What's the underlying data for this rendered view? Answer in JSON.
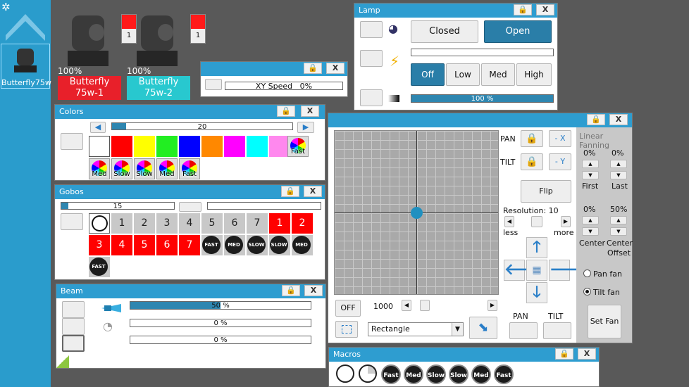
{
  "sidebar": {
    "fixture_label": "Butterfly75w",
    "up_icon": "chevron-up-icon",
    "settings_icon": "gear-icon"
  },
  "fixtures": [
    {
      "intensity": "100%",
      "name_line1": "Butterfly",
      "name_line2": "75w-1",
      "badge": "1",
      "color": "#e8202a"
    },
    {
      "intensity": "100%",
      "name_line1": "Butterfly",
      "name_line2": "75w-2",
      "badge": "1",
      "color": "#28c8cf"
    }
  ],
  "xy_speed": {
    "label": "XY Speed",
    "value": "0%",
    "close": "X"
  },
  "lamp": {
    "title": "Lamp",
    "close": "X",
    "closed": "Closed",
    "open": "Open",
    "off": "Off",
    "low": "Low",
    "med": "Med",
    "high": "High",
    "dimmer": "100 %",
    "dimmer_fraction": 1.0
  },
  "colors": {
    "title": "Colors",
    "close": "X",
    "value": "20",
    "value_fraction": 0.08,
    "swatches": [
      "#ffffff",
      "#ff0000",
      "#ffff00",
      "#22ee22",
      "#0000ff",
      "#ff8800",
      "#ff00ff",
      "#00ffff",
      "#ff88ee"
    ],
    "wheel_labels": [
      "Fast",
      "Med",
      "Slow",
      "Slow",
      "Med",
      "Fast"
    ]
  },
  "gobos": {
    "title": "Gobos",
    "close": "X",
    "value": "15",
    "value_fraction": 0.06,
    "row1": [
      "1",
      "2",
      "3",
      "4",
      "5",
      "6",
      "7",
      "1",
      "2"
    ],
    "row2": [
      "3",
      "4",
      "5",
      "6",
      "7"
    ],
    "rot_labels": [
      "FAST",
      "MED",
      "SLOW",
      "SLOW",
      "MED",
      "FAST"
    ]
  },
  "beam": {
    "title": "Beam",
    "close": "X",
    "bars": [
      {
        "text": "50 %",
        "fraction": 0.5
      },
      {
        "text": "0 %",
        "fraction": 0
      },
      {
        "text": "0 %",
        "fraction": 0
      }
    ]
  },
  "position": {
    "close": "X",
    "pan": "PAN",
    "tilt": "TILT",
    "minus_x": "- X",
    "minus_y": "- Y",
    "flip": "Flip",
    "resolution": "Resolution: 10",
    "less": "less",
    "more": "more",
    "off": "OFF",
    "speed": "1000",
    "shape": "Rectangle",
    "pan_btn": "PAN",
    "tilt_btn": "TILT",
    "fanning": {
      "title": "Linear Fanning",
      "first_val": "0%",
      "last_val": "0%",
      "first": "First",
      "last": "Last",
      "center_val": "0%",
      "offset_val": "50%",
      "center": "Center",
      "center2": "Center",
      "offset": "Offset",
      "pan_fan": "Pan fan",
      "tilt_fan": "Tilt fan",
      "set_fan": "Set Fan"
    }
  },
  "macros": {
    "title": "Macros",
    "close": "X",
    "labels": [
      "Fast",
      "Med",
      "Slow",
      "Slow",
      "Med",
      "Fast"
    ]
  }
}
